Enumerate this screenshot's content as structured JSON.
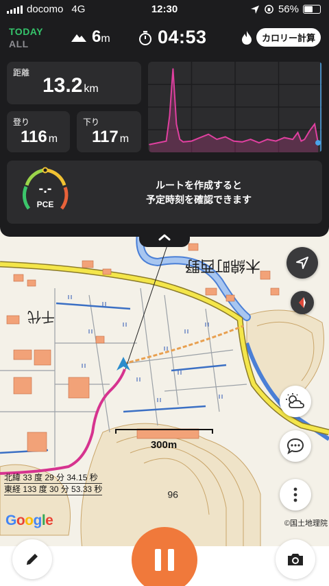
{
  "status_bar": {
    "carrier": "docomo",
    "network": "4G",
    "time": "12:30",
    "battery": "56%"
  },
  "summary": {
    "period_active": "TODAY",
    "period_inactive": "ALL",
    "altitude_value": "6",
    "altitude_unit": "m",
    "elapsed_time": "04:53",
    "calorie_button": "カロリー計算"
  },
  "stats": {
    "distance_label": "距離",
    "distance_value": "13.2",
    "distance_unit": "km",
    "ascent_label": "登り",
    "ascent_value": "116",
    "ascent_unit": "m",
    "descent_label": "下り",
    "descent_value": "117",
    "descent_unit": "m"
  },
  "pace": {
    "value": "-.-",
    "label": "PCE",
    "message_line1": "ルートを作成すると",
    "message_line2": "予定時刻を確認できます"
  },
  "map": {
    "scale_label": "300m",
    "latitude": "北緯 33 度 29 分 34.15 秒",
    "longitude": "東経 133 度 30 分 53.33 秒",
    "google_logo": "Google",
    "attribution": "©国土地理院"
  },
  "icons": {
    "altitude": "mountain-icon",
    "timer": "stopwatch-icon",
    "calorie": "flame-icon",
    "expand": "chevron-up-icon",
    "locate": "location-arrow-icon",
    "compass": "compass-icon",
    "weather": "weather-icon",
    "chat": "chat-icon",
    "more": "more-vertical-icon",
    "edit": "pencil-icon",
    "pause": "pause-icon",
    "camera": "camera-icon"
  },
  "colors": {
    "background": "#1c1c1e",
    "card": "#2c2c2e",
    "today_green": "#35c46b",
    "pause_orange": "#f0793b",
    "track_magenta": "#d6338f",
    "elevation_line": "#e040a0"
  },
  "chart_data": {
    "type": "area",
    "title": "",
    "xlabel": "",
    "ylabel": "",
    "x": [
      0,
      5,
      10,
      12,
      14,
      16,
      18,
      20,
      25,
      30,
      35,
      40,
      45,
      50,
      55,
      60,
      65,
      70,
      75,
      80,
      85,
      88,
      90,
      92,
      95,
      98,
      100
    ],
    "series": [
      {
        "values": [
          6,
          8,
          10,
          40,
          95,
          30,
          12,
          9,
          10,
          14,
          18,
          12,
          15,
          10,
          9,
          12,
          8,
          12,
          10,
          14,
          12,
          20,
          10,
          12,
          22,
          30,
          8
        ]
      }
    ],
    "ylim": [
      0,
      100
    ],
    "grid": true
  }
}
